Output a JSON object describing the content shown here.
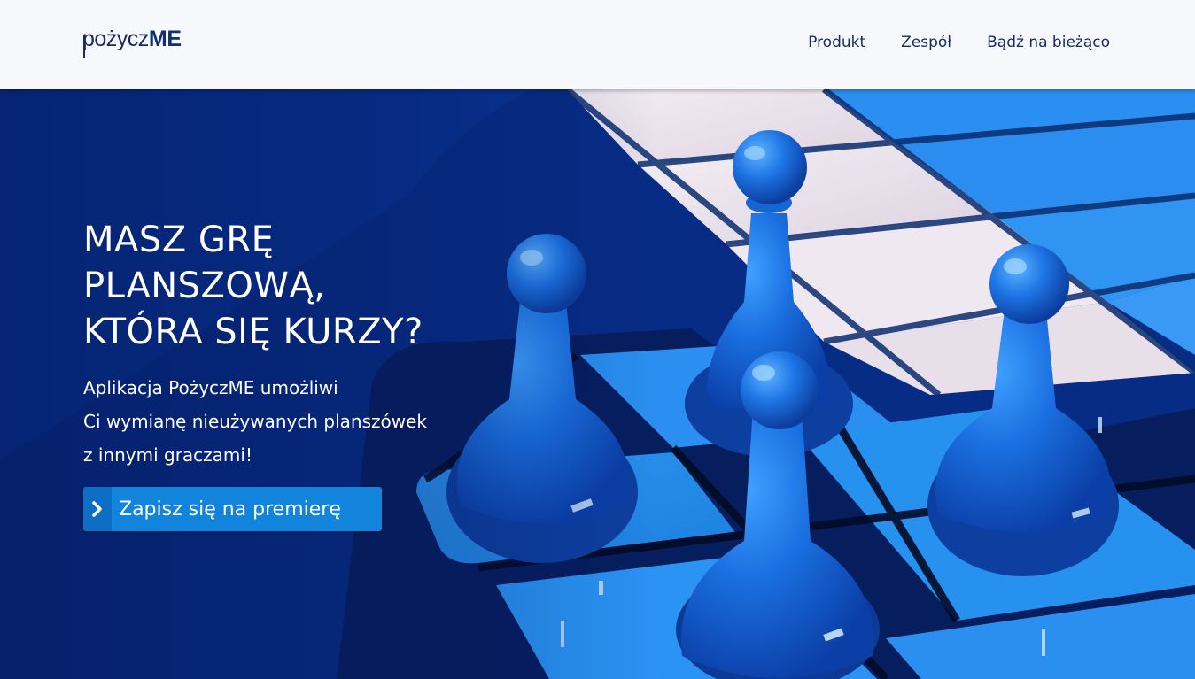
{
  "header": {
    "logo": {
      "regular": "pożycz",
      "bold": "ME"
    },
    "nav": [
      {
        "label": "Produkt"
      },
      {
        "label": "Zespół"
      },
      {
        "label": "Bądź na bieżąco"
      }
    ]
  },
  "hero": {
    "headline": [
      "MASZ GRĘ",
      "PLANSZOWĄ,",
      "KTÓRA SIĘ KURZY?"
    ],
    "subtext": [
      "Aplikacja PożyczME umożliwi",
      "Ci wymianę nieużywanych planszówek",
      "z innymi graczami!"
    ],
    "cta": {
      "label": "Zapisz się na premierę",
      "icon": "chevron-right-icon"
    }
  },
  "colors": {
    "header_bg": "#f6f8fc",
    "brand_navy": "#1a2a5c",
    "hero_bg": "#072f8c",
    "cta_blue": "#1384dc",
    "pawn_blue": "#1668d8"
  },
  "background_image": "blue board game pawns on a checkered board"
}
